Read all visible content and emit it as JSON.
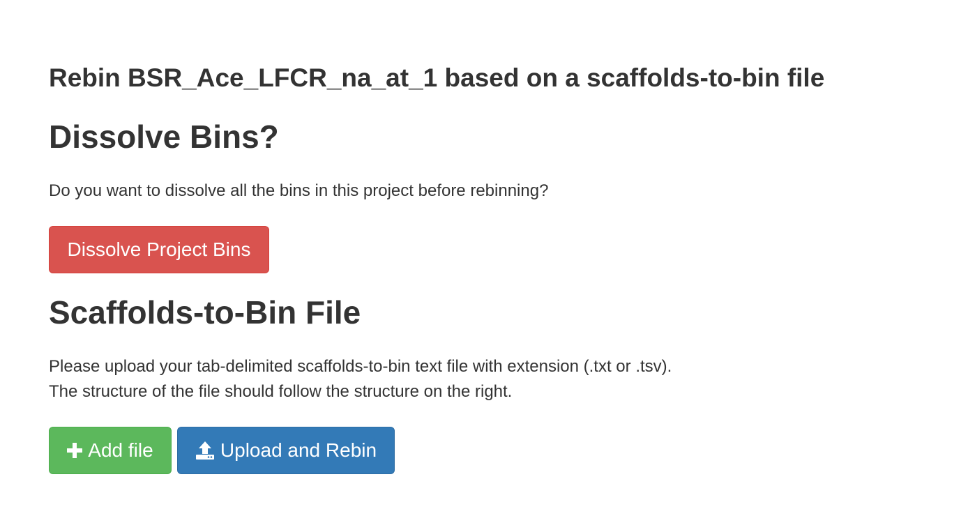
{
  "page": {
    "title": "Rebin BSR_Ace_LFCR_na_at_1 based on a scaffolds-to-bin file"
  },
  "dissolve": {
    "heading": "Dissolve Bins?",
    "description": "Do you want to dissolve all the bins in this project before rebinning?",
    "button_label": "Dissolve Project Bins"
  },
  "scaffolds": {
    "heading": "Scaffolds-to-Bin File",
    "description_line1": "Please upload your tab-delimited scaffolds-to-bin text file with extension (.txt or .tsv).",
    "description_line2": "The structure of the file should follow the structure on the right.",
    "add_file_label": "Add file",
    "upload_label": "Upload and Rebin"
  },
  "icons": {
    "add_file": "plus-icon",
    "upload": "upload-icon"
  },
  "colors": {
    "danger": "#d9534f",
    "success": "#5cb85c",
    "primary": "#337ab7",
    "text": "#333333"
  }
}
